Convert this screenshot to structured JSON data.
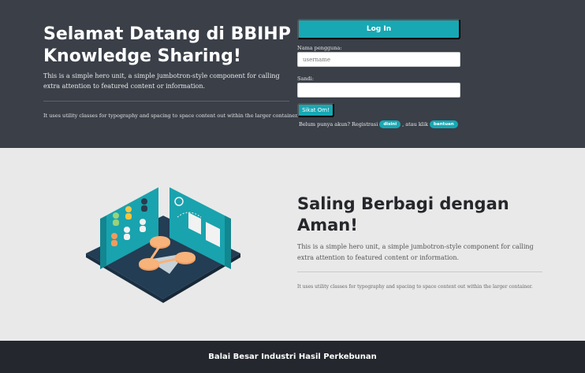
{
  "hero": {
    "title": "Selamat Datang di BBIHP Knowledge Sharing!",
    "lead": "This is a simple hero unit, a simple jumbotron-style component for calling extra attention to featured content or information.",
    "small": "It uses utility classes for typography and spacing to space content out within the larger container."
  },
  "login": {
    "login_label": "Log In",
    "username_label": "Nama pengguna:",
    "username_placeholder": "username",
    "username_value": "",
    "password_label": "Sandi:",
    "password_value": "",
    "submit_label": "Sikat Om!",
    "signup_prefix": "Belum punya akun? Registrasi",
    "signup_link": "disini",
    "help_prefix": ", atau klik",
    "help_link": "bantuan"
  },
  "section": {
    "title": "Saling Berbagi dengan Aman!",
    "lead": "This is a simple hero unit, a simple jumbotron-style component for calling extra attention to featured content or information.",
    "small": "It uses utility classes for typography and spacing to space content out within the larger container."
  },
  "illustration": {
    "icon": "knowledge-sharing-illustration"
  },
  "footer": {
    "text": "Balai Besar Industri Hasil Perkebunan"
  },
  "colors": {
    "hero_bg": "#3a3f48",
    "accent": "#17a8b4",
    "page_bg": "#e9e9e9",
    "footer_bg": "#24272d"
  }
}
